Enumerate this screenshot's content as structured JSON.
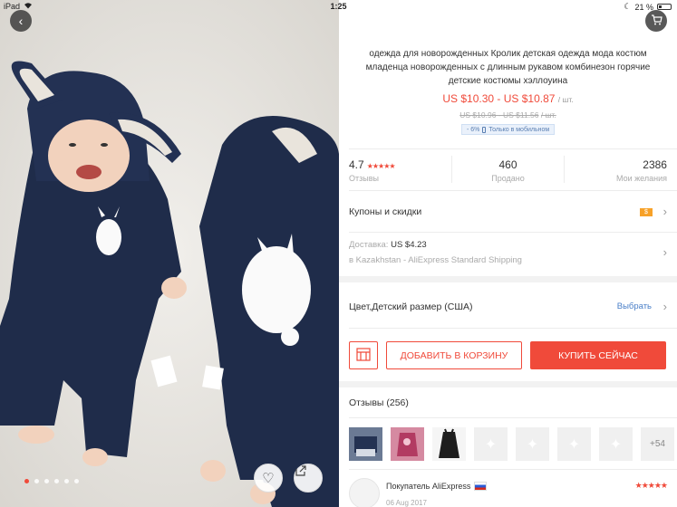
{
  "status_bar": {
    "device": "iPad",
    "time": "1:25",
    "battery": "21 %"
  },
  "gallery": {
    "dots_total": 6,
    "active_dot": 0
  },
  "product": {
    "title": "одежда для новорожденных Кролик детская одежда мода костюм младенца новорожденных с длинным рукавом комбинезон горячие детские костюмы хэллоуина",
    "price": "US $10.30 - US $10.87",
    "price_unit": "/ шт.",
    "old_price": "US $10.96 - US $11.56",
    "old_price_unit": "/ шт.",
    "mobile_discount": "- 6%",
    "mobile_label": "Только в мобильном"
  },
  "stats": {
    "rating": "4.7",
    "rating_stars": "★★★★★",
    "rating_label": "Отзывы",
    "orders": "460",
    "orders_label": "Продано",
    "wishlist": "2386",
    "wishlist_label": "Мои желания"
  },
  "coupons": {
    "label": "Купоны и скидки",
    "badge": "$"
  },
  "shipping": {
    "label": "Доставка:",
    "cost": "US $4.23",
    "detail": "в Kazakhstan - AliExpress Standard Shipping"
  },
  "variant": {
    "label": "Цвет,Детский размер (США)",
    "action": "Выбрать"
  },
  "actions": {
    "add_to_cart": "ДОБАВИТЬ В КОРЗИНУ",
    "buy_now": "КУПИТЬ СЕЙЧАС"
  },
  "reviews": {
    "header": "Отзывы (256)",
    "more_photos": "+54",
    "first": {
      "author": "Покупатель AliExpress",
      "date": "06 Aug 2017",
      "stars": "★★★★★"
    }
  },
  "colors": {
    "accent": "#f04a3a",
    "link": "#4a7fc8",
    "coupon": "#f7a128"
  }
}
